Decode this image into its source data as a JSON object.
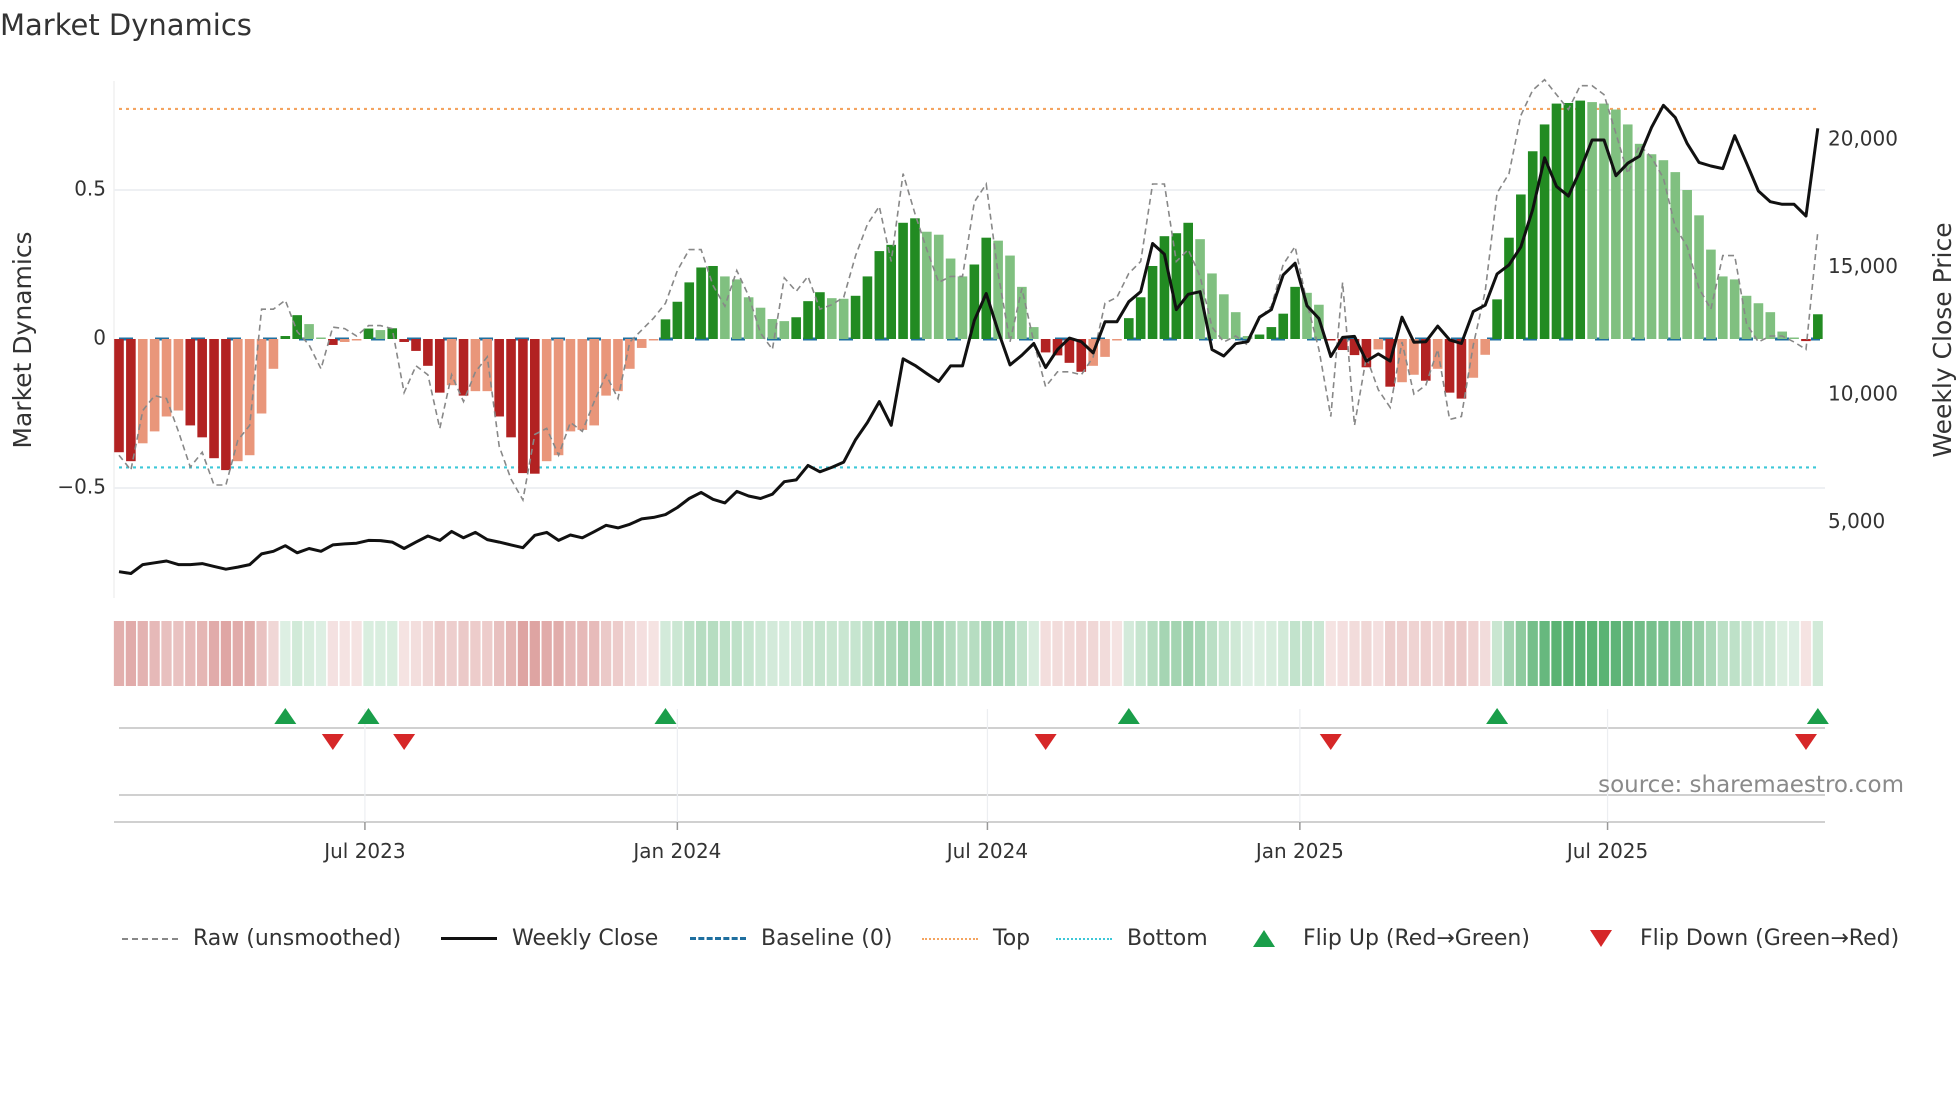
{
  "title": "Market Dynamics",
  "source": "source: sharemaestro.com",
  "colors": {
    "strong_red": "#b22222",
    "weak_red": "#e9967a",
    "strong_green": "#228b22",
    "weak_green": "#80c080",
    "raw": "#888888",
    "close": "#111111",
    "baseline": "#1f6f9f",
    "top": "#f4a460",
    "bottom": "#3cc8d8",
    "flip_up": "#1a9e4a",
    "flip_down": "#d62728"
  },
  "legend": [
    {
      "label": "Raw (unsmoothed)",
      "icon": "dashed-gray-line"
    },
    {
      "label": "Weekly Close",
      "icon": "solid-black-line"
    },
    {
      "label": "Baseline (0)",
      "icon": "dashed-blue-line"
    },
    {
      "label": "Top",
      "icon": "dotted-orange-line"
    },
    {
      "label": "Bottom",
      "icon": "dotted-cyan-line"
    },
    {
      "label": "Flip Up (Red→Green)",
      "icon": "triangle-up"
    },
    {
      "label": "Flip Down (Green→Red)",
      "icon": "triangle-down"
    }
  ],
  "chart_data": {
    "type": "bar",
    "title": "Market Dynamics",
    "ylabel": "Market Dynamics",
    "ylabel_right": "Weekly Close Price",
    "ylim": [
      -0.82,
      0.9
    ],
    "ylim_right": [
      2000,
      22500
    ],
    "yticks": [
      {
        "v": 0.5,
        "label": "0.5"
      },
      {
        "v": 0,
        "label": "0"
      },
      {
        "v": -0.5,
        "label": "−0.5"
      }
    ],
    "yticks_right": [
      {
        "v": 20000,
        "label": "20,000"
      },
      {
        "v": 15000,
        "label": "15,000"
      },
      {
        "v": 10000,
        "label": "10,000"
      },
      {
        "v": 5000,
        "label": "5,000"
      }
    ],
    "xticks": [
      {
        "week": 21.7,
        "label": "Jul 2023"
      },
      {
        "week": 48.0,
        "label": "Jan 2024"
      },
      {
        "week": 74.1,
        "label": "Jul 2024"
      },
      {
        "week": 100.4,
        "label": "Jan 2025"
      },
      {
        "week": 126.3,
        "label": "Jul 2025"
      }
    ],
    "top_level": 0.772,
    "bottom_level": -0.431,
    "baseline": 0,
    "weeks": 144,
    "series": [
      {
        "name": "Market Dynamics",
        "values": [
          -0.38,
          -0.41,
          -0.35,
          -0.31,
          -0.26,
          -0.24,
          -0.29,
          -0.33,
          -0.4,
          -0.44,
          -0.41,
          -0.39,
          -0.25,
          -0.1,
          0.01,
          0.08,
          0.05,
          0.005,
          -0.02,
          -0.01,
          -0.005,
          0.035,
          0.03,
          0.036,
          -0.01,
          -0.04,
          -0.09,
          -0.18,
          -0.155,
          -0.19,
          -0.175,
          -0.175,
          -0.26,
          -0.33,
          -0.45,
          -0.452,
          -0.41,
          -0.39,
          -0.31,
          -0.305,
          -0.29,
          -0.19,
          -0.175,
          -0.1,
          -0.03,
          -0.005,
          0.066,
          0.125,
          0.19,
          0.24,
          0.245,
          0.21,
          0.2,
          0.14,
          0.105,
          0.067,
          0.06,
          0.073,
          0.127,
          0.157,
          0.137,
          0.135,
          0.145,
          0.21,
          0.295,
          0.316,
          0.39,
          0.405,
          0.36,
          0.35,
          0.27,
          0.21,
          0.25,
          0.34,
          0.33,
          0.28,
          0.175,
          0.04,
          -0.045,
          -0.055,
          -0.08,
          -0.11,
          -0.09,
          -0.06,
          -0.005,
          0.07,
          0.14,
          0.245,
          0.345,
          0.355,
          0.39,
          0.335,
          0.22,
          0.15,
          0.09,
          0.01,
          0.015,
          0.04,
          0.085,
          0.175,
          0.155,
          0.115,
          -0.005,
          -0.037,
          -0.054,
          -0.095,
          -0.035,
          -0.16,
          -0.145,
          -0.12,
          -0.14,
          -0.1,
          -0.18,
          -0.2,
          -0.13,
          -0.053,
          0.133,
          0.34,
          0.485,
          0.63,
          0.72,
          0.79,
          0.792,
          0.8,
          0.795,
          0.79,
          0.77,
          0.72,
          0.655,
          0.62,
          0.6,
          0.56,
          0.5,
          0.415,
          0.3,
          0.21,
          0.2,
          0.145,
          0.12,
          0.09,
          0.025,
          0.005,
          -0.007,
          0.083
        ]
      },
      {
        "name": "Raw (unsmoothed)",
        "values": [
          -0.39,
          -0.44,
          -0.24,
          -0.19,
          -0.2,
          -0.31,
          -0.43,
          -0.38,
          -0.49,
          -0.49,
          -0.34,
          -0.29,
          0.1,
          0.1,
          0.13,
          0.025,
          -0.02,
          -0.1,
          0.04,
          0.035,
          0.01,
          0.045,
          0.045,
          0.035,
          -0.18,
          -0.09,
          -0.12,
          -0.3,
          -0.12,
          -0.21,
          -0.11,
          -0.06,
          -0.36,
          -0.47,
          -0.54,
          -0.32,
          -0.3,
          -0.39,
          -0.28,
          -0.31,
          -0.21,
          -0.12,
          -0.2,
          -0.01,
          0.03,
          0.07,
          0.12,
          0.23,
          0.3,
          0.3,
          0.18,
          0.11,
          0.23,
          0.145,
          0.02,
          -0.035,
          0.205,
          0.16,
          0.21,
          0.1,
          0.115,
          0.14,
          0.28,
          0.385,
          0.445,
          0.26,
          0.555,
          0.42,
          0.3,
          0.19,
          0.21,
          0.21,
          0.46,
          0.52,
          0.22,
          -0.01,
          0.17,
          -0.01,
          -0.16,
          -0.11,
          -0.11,
          -0.12,
          -0.06,
          0.12,
          0.14,
          0.22,
          0.26,
          0.52,
          0.52,
          0.26,
          0.3,
          0.21,
          0.04,
          -0.01,
          0.01,
          -0.02,
          0.07,
          0.11,
          0.25,
          0.31,
          0.12,
          -0.035,
          -0.26,
          0.19,
          -0.29,
          -0.06,
          -0.17,
          -0.23,
          -0.01,
          -0.185,
          -0.155,
          -0.035,
          -0.27,
          -0.26,
          -0.02,
          0.16,
          0.49,
          0.555,
          0.75,
          0.835,
          0.87,
          0.82,
          0.77,
          0.85,
          0.85,
          0.82,
          0.69,
          0.555,
          0.65,
          0.61,
          0.54,
          0.375,
          0.31,
          0.17,
          0.1,
          0.28,
          0.28,
          0.05,
          -0.01,
          0.01,
          0.01,
          -0.01,
          -0.035,
          0.36
        ]
      },
      {
        "name": "Weekly Close",
        "axis": "right",
        "values": [
          3070,
          3000,
          3350,
          3420,
          3490,
          3350,
          3350,
          3390,
          3280,
          3170,
          3250,
          3350,
          3770,
          3870,
          4090,
          3810,
          3980,
          3870,
          4120,
          4160,
          4190,
          4300,
          4290,
          4230,
          3980,
          4230,
          4470,
          4300,
          4650,
          4400,
          4610,
          4330,
          4230,
          4120,
          4010,
          4500,
          4610,
          4300,
          4510,
          4400,
          4640,
          4890,
          4790,
          4930,
          5140,
          5200,
          5310,
          5590,
          5940,
          6180,
          5910,
          5770,
          6220,
          6040,
          5940,
          6110,
          6600,
          6670,
          7240,
          6990,
          7160,
          7370,
          8250,
          8920,
          9740,
          8810,
          11420,
          11160,
          10840,
          10530,
          11140,
          11140,
          12930,
          13980,
          12510,
          11180,
          11560,
          12020,
          11080,
          11780,
          12230,
          12090,
          11650,
          12870,
          12870,
          13660,
          14050,
          15940,
          15520,
          13350,
          13950,
          14050,
          11780,
          11530,
          12010,
          12090,
          13050,
          13350,
          14710,
          15170,
          13500,
          13000,
          11510,
          12260,
          12300,
          11330,
          11610,
          11330,
          13050,
          12070,
          12090,
          12700,
          12160,
          12020,
          13280,
          13520,
          14750,
          15100,
          15800,
          17270,
          19300,
          18180,
          17800,
          18810,
          20000,
          20000,
          18600,
          19090,
          19370,
          20490,
          21360,
          20880,
          19860,
          19120,
          18980,
          18880,
          20170,
          19090,
          18000,
          17580,
          17480,
          17480,
          17020,
          20460
        ]
      }
    ],
    "flip_up_weeks": [
      15,
      22,
      47,
      86,
      117,
      144
    ],
    "flip_down_weeks": [
      19,
      25,
      79,
      103,
      143
    ],
    "legend_position": "bottom"
  }
}
